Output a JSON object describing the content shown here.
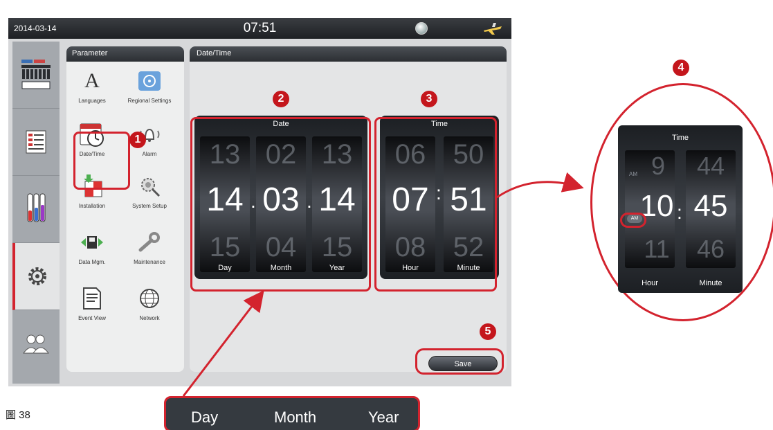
{
  "status_bar": {
    "date": "2014-03-14",
    "time": "07:51"
  },
  "parameter_panel": {
    "title": "Parameter",
    "items": [
      {
        "label": "Languages",
        "icon": "letter-a-icon"
      },
      {
        "label": "Regional Settings",
        "icon": "regional-settings-icon"
      },
      {
        "label": "Date/Time",
        "icon": "date-time-icon"
      },
      {
        "label": "Alarm",
        "icon": "alarm-bell-icon"
      },
      {
        "label": "Installation",
        "icon": "installation-icon"
      },
      {
        "label": "System Setup",
        "icon": "system-setup-icon"
      },
      {
        "label": "Data Mgm.",
        "icon": "data-management-icon"
      },
      {
        "label": "Maintenance",
        "icon": "wrench-icon"
      },
      {
        "label": "Event View",
        "icon": "event-view-icon"
      },
      {
        "label": "Network",
        "icon": "network-globe-icon"
      }
    ]
  },
  "datetime_panel": {
    "title": "Date/Time",
    "date_roller": {
      "title": "Date",
      "day": {
        "prev": "13",
        "value": "14",
        "next": "15",
        "label": "Day"
      },
      "month": {
        "prev": "02",
        "value": "03",
        "next": "04",
        "label": "Month"
      },
      "year": {
        "prev": "13",
        "value": "14",
        "next": "15",
        "label": "Year"
      }
    },
    "time_roller": {
      "title": "Time",
      "hour": {
        "prev": "06",
        "value": "07",
        "next": "08",
        "label": "Hour"
      },
      "minute": {
        "prev": "50",
        "value": "51",
        "next": "52",
        "label": "Minute"
      }
    },
    "save_label": "Save"
  },
  "callouts": [
    "1",
    "2",
    "3",
    "4",
    "5"
  ],
  "zoom_time": {
    "title": "Time",
    "hour": {
      "prev": "9",
      "value": "10",
      "next": "11",
      "label": "Hour"
    },
    "minute": {
      "prev": "44",
      "value": "45",
      "next": "46",
      "label": "Minute"
    },
    "ampm_prev": "AM",
    "ampm": "AM"
  },
  "bottom_labels": {
    "day": "Day",
    "month": "Month",
    "year": "Year"
  },
  "figure_label": "圖 38",
  "colors": {
    "accent_red": "#d3232e",
    "callout_red": "#c4161c",
    "header_dark": "#2c2f33"
  }
}
